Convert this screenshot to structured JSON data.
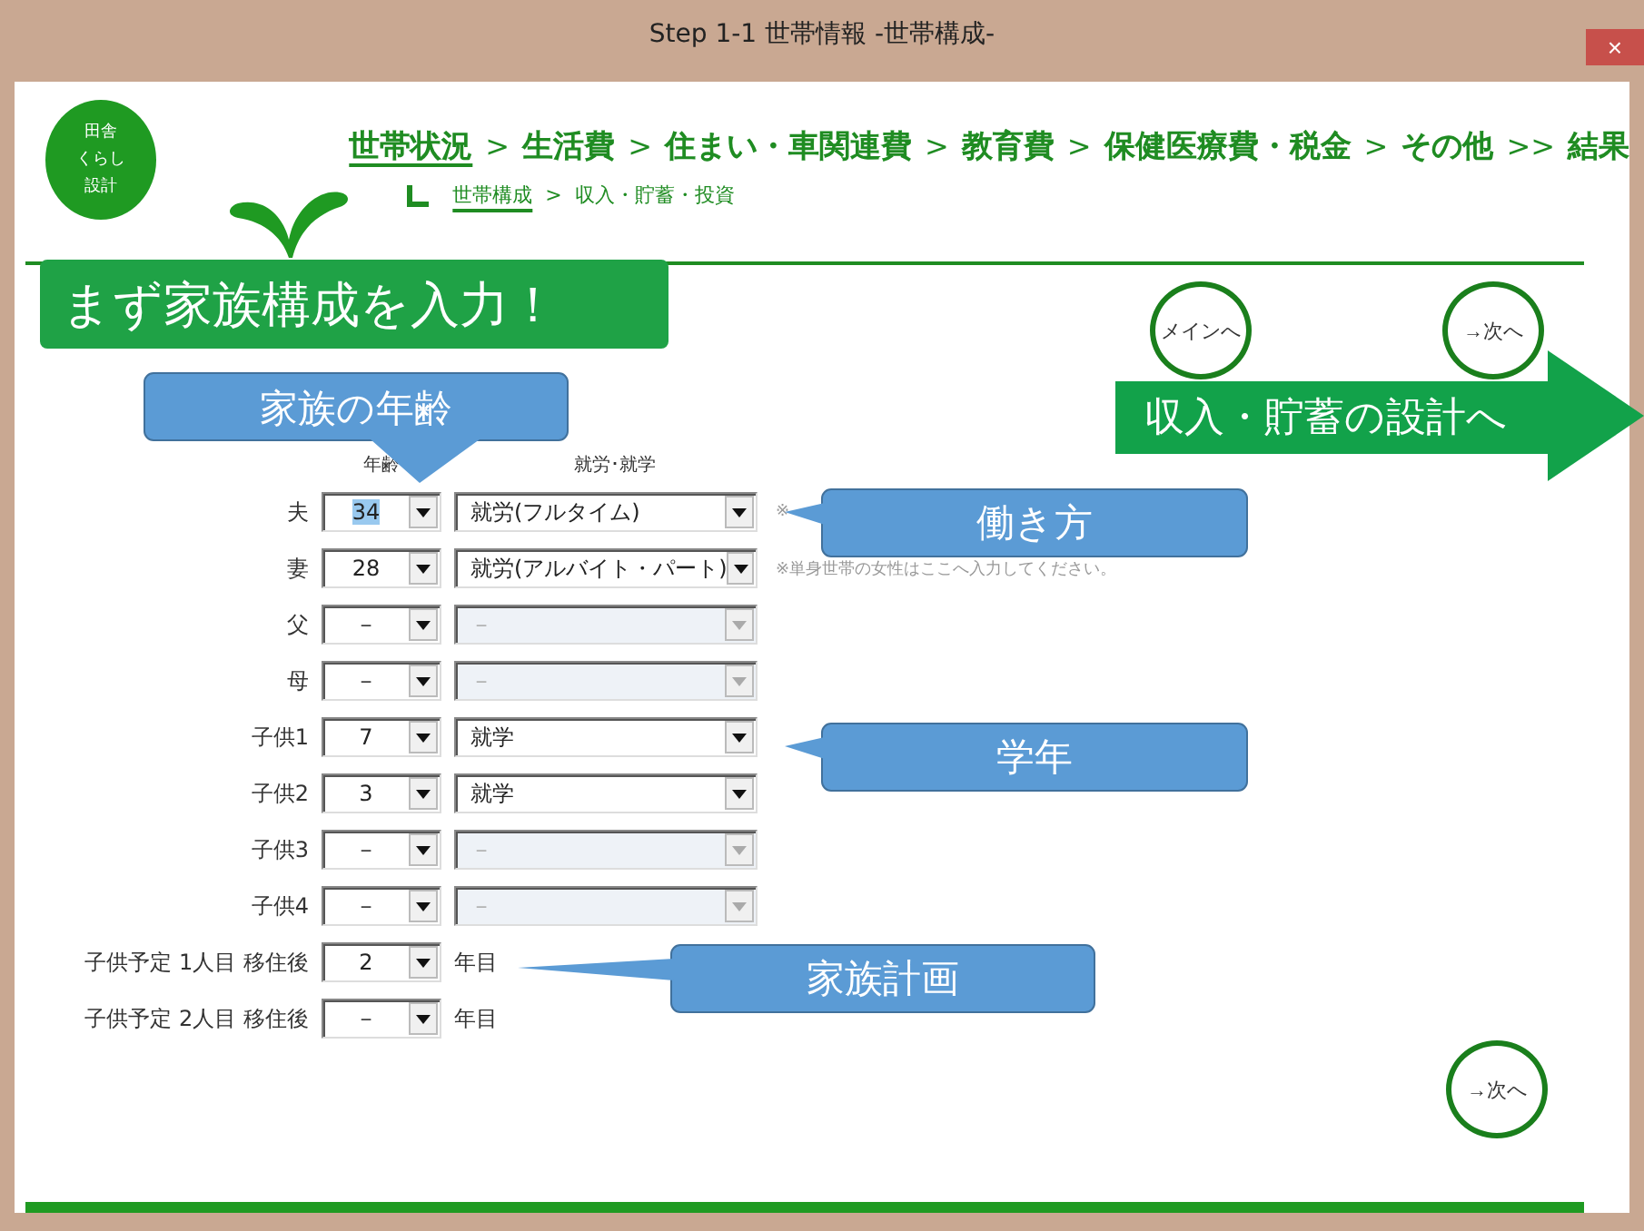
{
  "window": {
    "title": "Step 1-1 世帯情報 -世帯構成-",
    "close": "×"
  },
  "logo": [
    "田舎",
    "くらし",
    "設計"
  ],
  "nav": [
    {
      "label": "世帯状況",
      "selected": true,
      "sep": ">"
    },
    {
      "label": "生活費",
      "selected": false,
      "sep": ">"
    },
    {
      "label": "住まい・車関連費",
      "selected": false,
      "sep": ">"
    },
    {
      "label": "教育費",
      "selected": false,
      "sep": ">"
    },
    {
      "label": "保健医療費・税金",
      "selected": false,
      "sep": ">"
    },
    {
      "label": "その他",
      "selected": false,
      "sep": ">>"
    },
    {
      "label": "結果",
      "selected": false
    }
  ],
  "subnav": [
    {
      "label": "世帯構成",
      "selected": true,
      "sep": ">"
    },
    {
      "label": "収入・貯蓄・投資",
      "selected": false
    }
  ],
  "banner": "まず家族構成を入力！",
  "buttons": {
    "main": "メインへ",
    "next_top": "→次へ",
    "next_bottom": "→次へ"
  },
  "arrow": "収入・貯蓄の設計へ",
  "columns": [
    "年齢",
    "就労･就学"
  ],
  "rows": [
    {
      "label": "夫",
      "age": "34",
      "age_highlighted": true,
      "job": "就労(フルタイム)",
      "job_disabled": false,
      "note": "※"
    },
    {
      "label": "妻",
      "age": "28",
      "age_highlighted": false,
      "job": "就労(アルバイト・パート)",
      "job_disabled": false,
      "note": "※単身世帯の女性はここへ入力してください。"
    },
    {
      "label": "父",
      "age": "－",
      "age_highlighted": false,
      "job": "－",
      "job_disabled": true
    },
    {
      "label": "母",
      "age": "－",
      "age_highlighted": false,
      "job": "－",
      "job_disabled": true
    },
    {
      "label": "子供1",
      "age": "7",
      "age_highlighted": false,
      "job": "就学",
      "job_disabled": false
    },
    {
      "label": "子供2",
      "age": "3",
      "age_highlighted": false,
      "job": "就学",
      "job_disabled": false
    },
    {
      "label": "子供3",
      "age": "－",
      "age_highlighted": false,
      "job": "－",
      "job_disabled": true
    },
    {
      "label": "子供4",
      "age": "－",
      "age_highlighted": false,
      "job": "－",
      "job_disabled": true
    }
  ],
  "plans": [
    {
      "label": "子供予定 1人目 移住後",
      "value": "2",
      "suffix": "年目"
    },
    {
      "label": "子供予定 2人目 移住後",
      "value": "－",
      "suffix": "年目"
    }
  ],
  "callouts": [
    {
      "text": "家族の年齢",
      "kind": "down"
    },
    {
      "text": "働き方",
      "kind": "left"
    },
    {
      "text": "学年",
      "kind": "left"
    },
    {
      "text": "家族計画",
      "kind": "left"
    }
  ]
}
